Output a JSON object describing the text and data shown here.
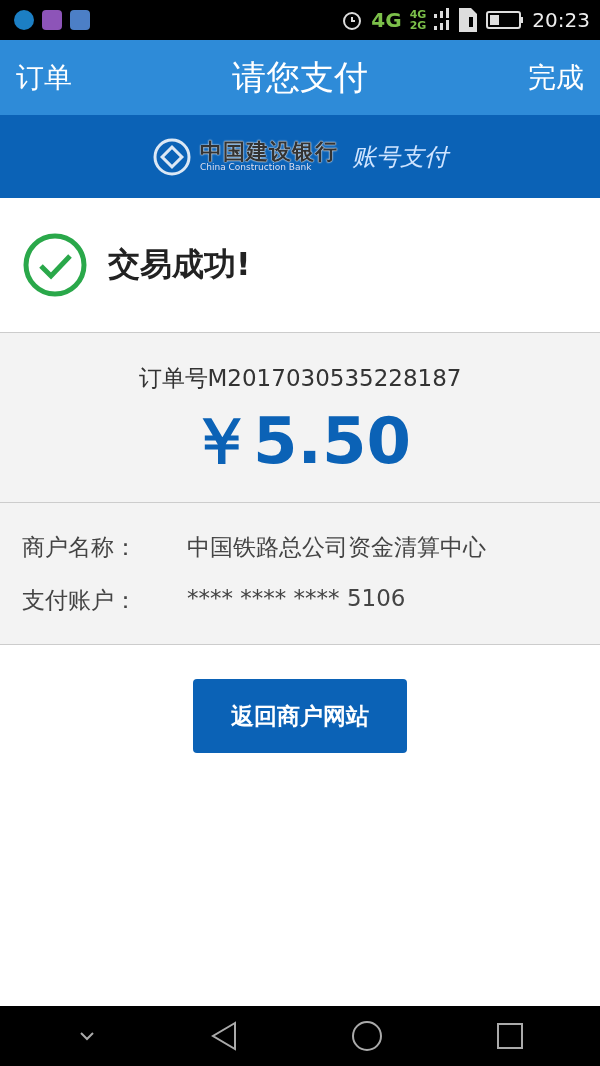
{
  "status_bar": {
    "network": "4G",
    "sim_1": "4G",
    "sim_2": "2G",
    "time": "20:23"
  },
  "nav": {
    "left": "订单",
    "title": "请您支付",
    "right": "完成"
  },
  "bank_banner": {
    "name_cn": "中国建设银行",
    "name_en": "China Construction Bank",
    "service": "账号支付"
  },
  "result": {
    "message": "交易成功!"
  },
  "order": {
    "number": "订单号M2017030535228187",
    "amount": "￥5.50"
  },
  "details": [
    {
      "label": "商户名称：",
      "value": "中国铁路总公司资金清算中心"
    },
    {
      "label": "支付账户：",
      "value": "**** **** **** 5106"
    }
  ],
  "return_button": "返回商户网站"
}
